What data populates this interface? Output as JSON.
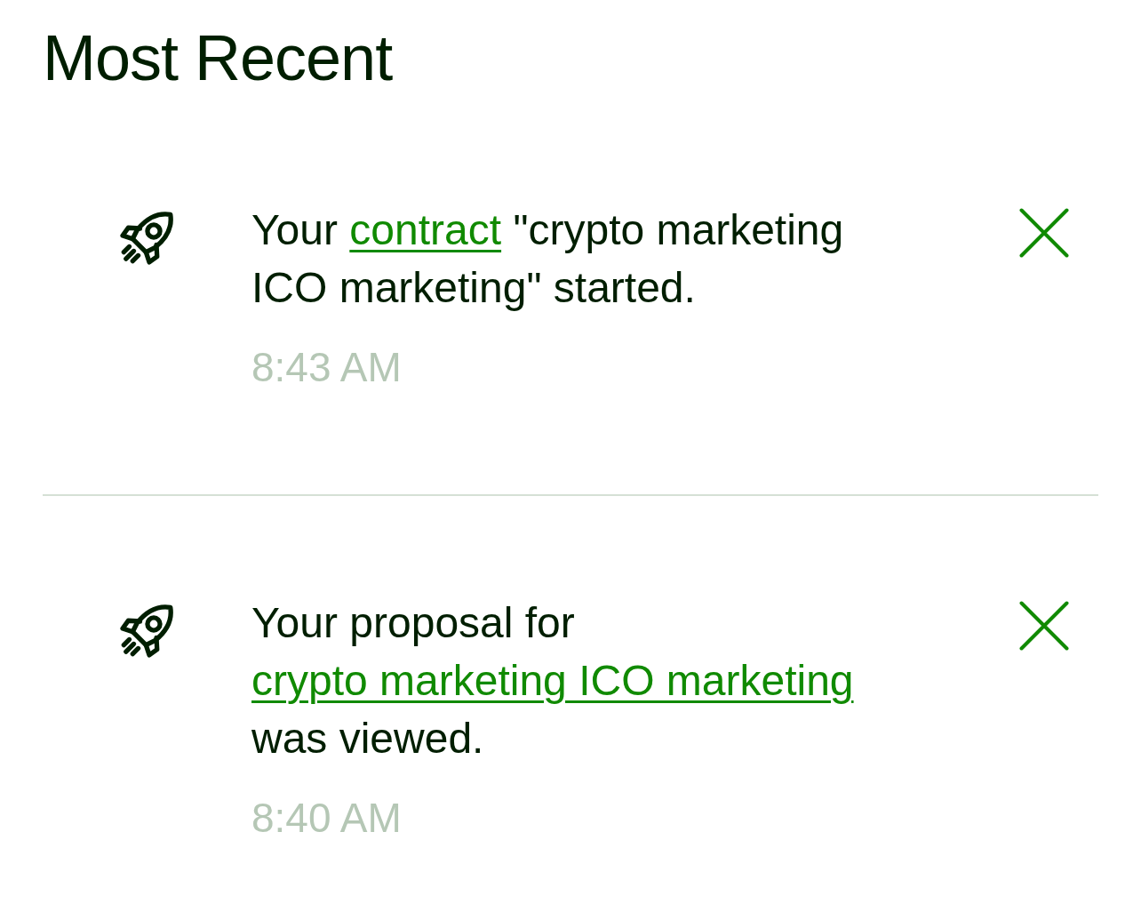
{
  "heading": "Most Recent",
  "notifications": [
    {
      "message": [
        {
          "kind": "text",
          "text": "Your "
        },
        {
          "kind": "link",
          "text": "contract"
        },
        {
          "kind": "text",
          "text": " \"crypto marketing ICO marketing\" started."
        }
      ],
      "time": "8:43 AM"
    },
    {
      "message": [
        {
          "kind": "text",
          "text": "Your proposal for "
        },
        {
          "kind": "link",
          "text": "crypto marketing ICO marketing"
        },
        {
          "kind": "text",
          "text": " was viewed."
        }
      ],
      "time": "8:40 AM"
    }
  ]
}
